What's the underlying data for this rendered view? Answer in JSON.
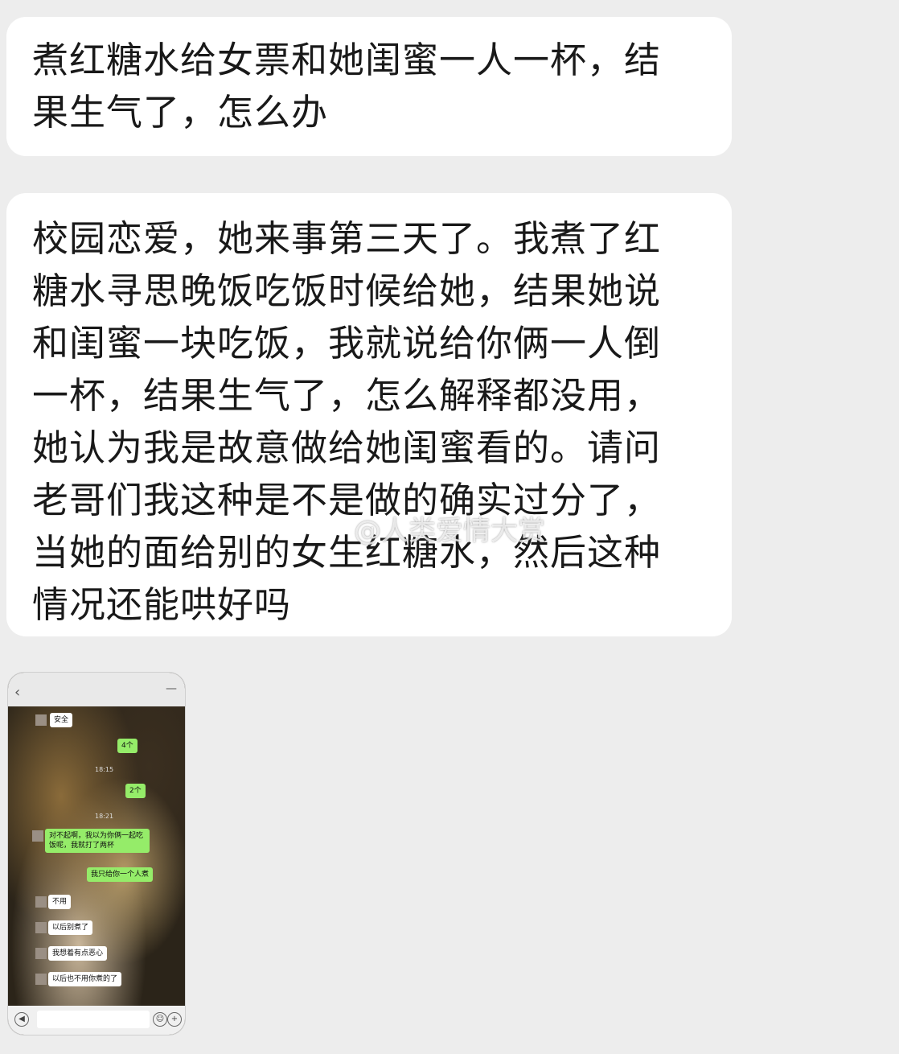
{
  "messages": [
    {
      "lines": [
        "煮红糖水给女票和她闺蜜一人一杯，结",
        "果生气了，怎么办"
      ]
    },
    {
      "lines": [
        "校园恋爱，她来事第三天了。我煮了红",
        "糖水寻思晚饭吃饭时候给她，结果她说",
        "和闺蜜一块吃饭，我就说给你俩一人倒",
        "一杯，结果生气了，怎么解释都没用，",
        "她认为我是故意做给她闺蜜看的。请问",
        "老哥们我这种是不是做的确实过分了，",
        "当她的面给别的女生红糖水，然后这种",
        "情况还能哄好吗"
      ]
    }
  ],
  "watermark": "@人类爱情大赏",
  "thumbnail": {
    "chat": [
      {
        "side": "in",
        "text": "安全"
      },
      {
        "side": "out",
        "text": "4个"
      },
      {
        "side": "time",
        "text": "18:15"
      },
      {
        "side": "out",
        "text": "2个"
      },
      {
        "side": "time",
        "text": "18:21"
      },
      {
        "side": "in",
        "text": "对不起啊，我以为你俩一起吃饭呢，我就打了两杯"
      },
      {
        "side": "out",
        "text": "我只给你一个人煮"
      },
      {
        "side": "in",
        "text": "不用"
      },
      {
        "side": "in",
        "text": "以后别煮了"
      },
      {
        "side": "in",
        "text": "我想着有点恶心"
      },
      {
        "side": "in",
        "text": "以后也不用你煮的了"
      }
    ]
  }
}
